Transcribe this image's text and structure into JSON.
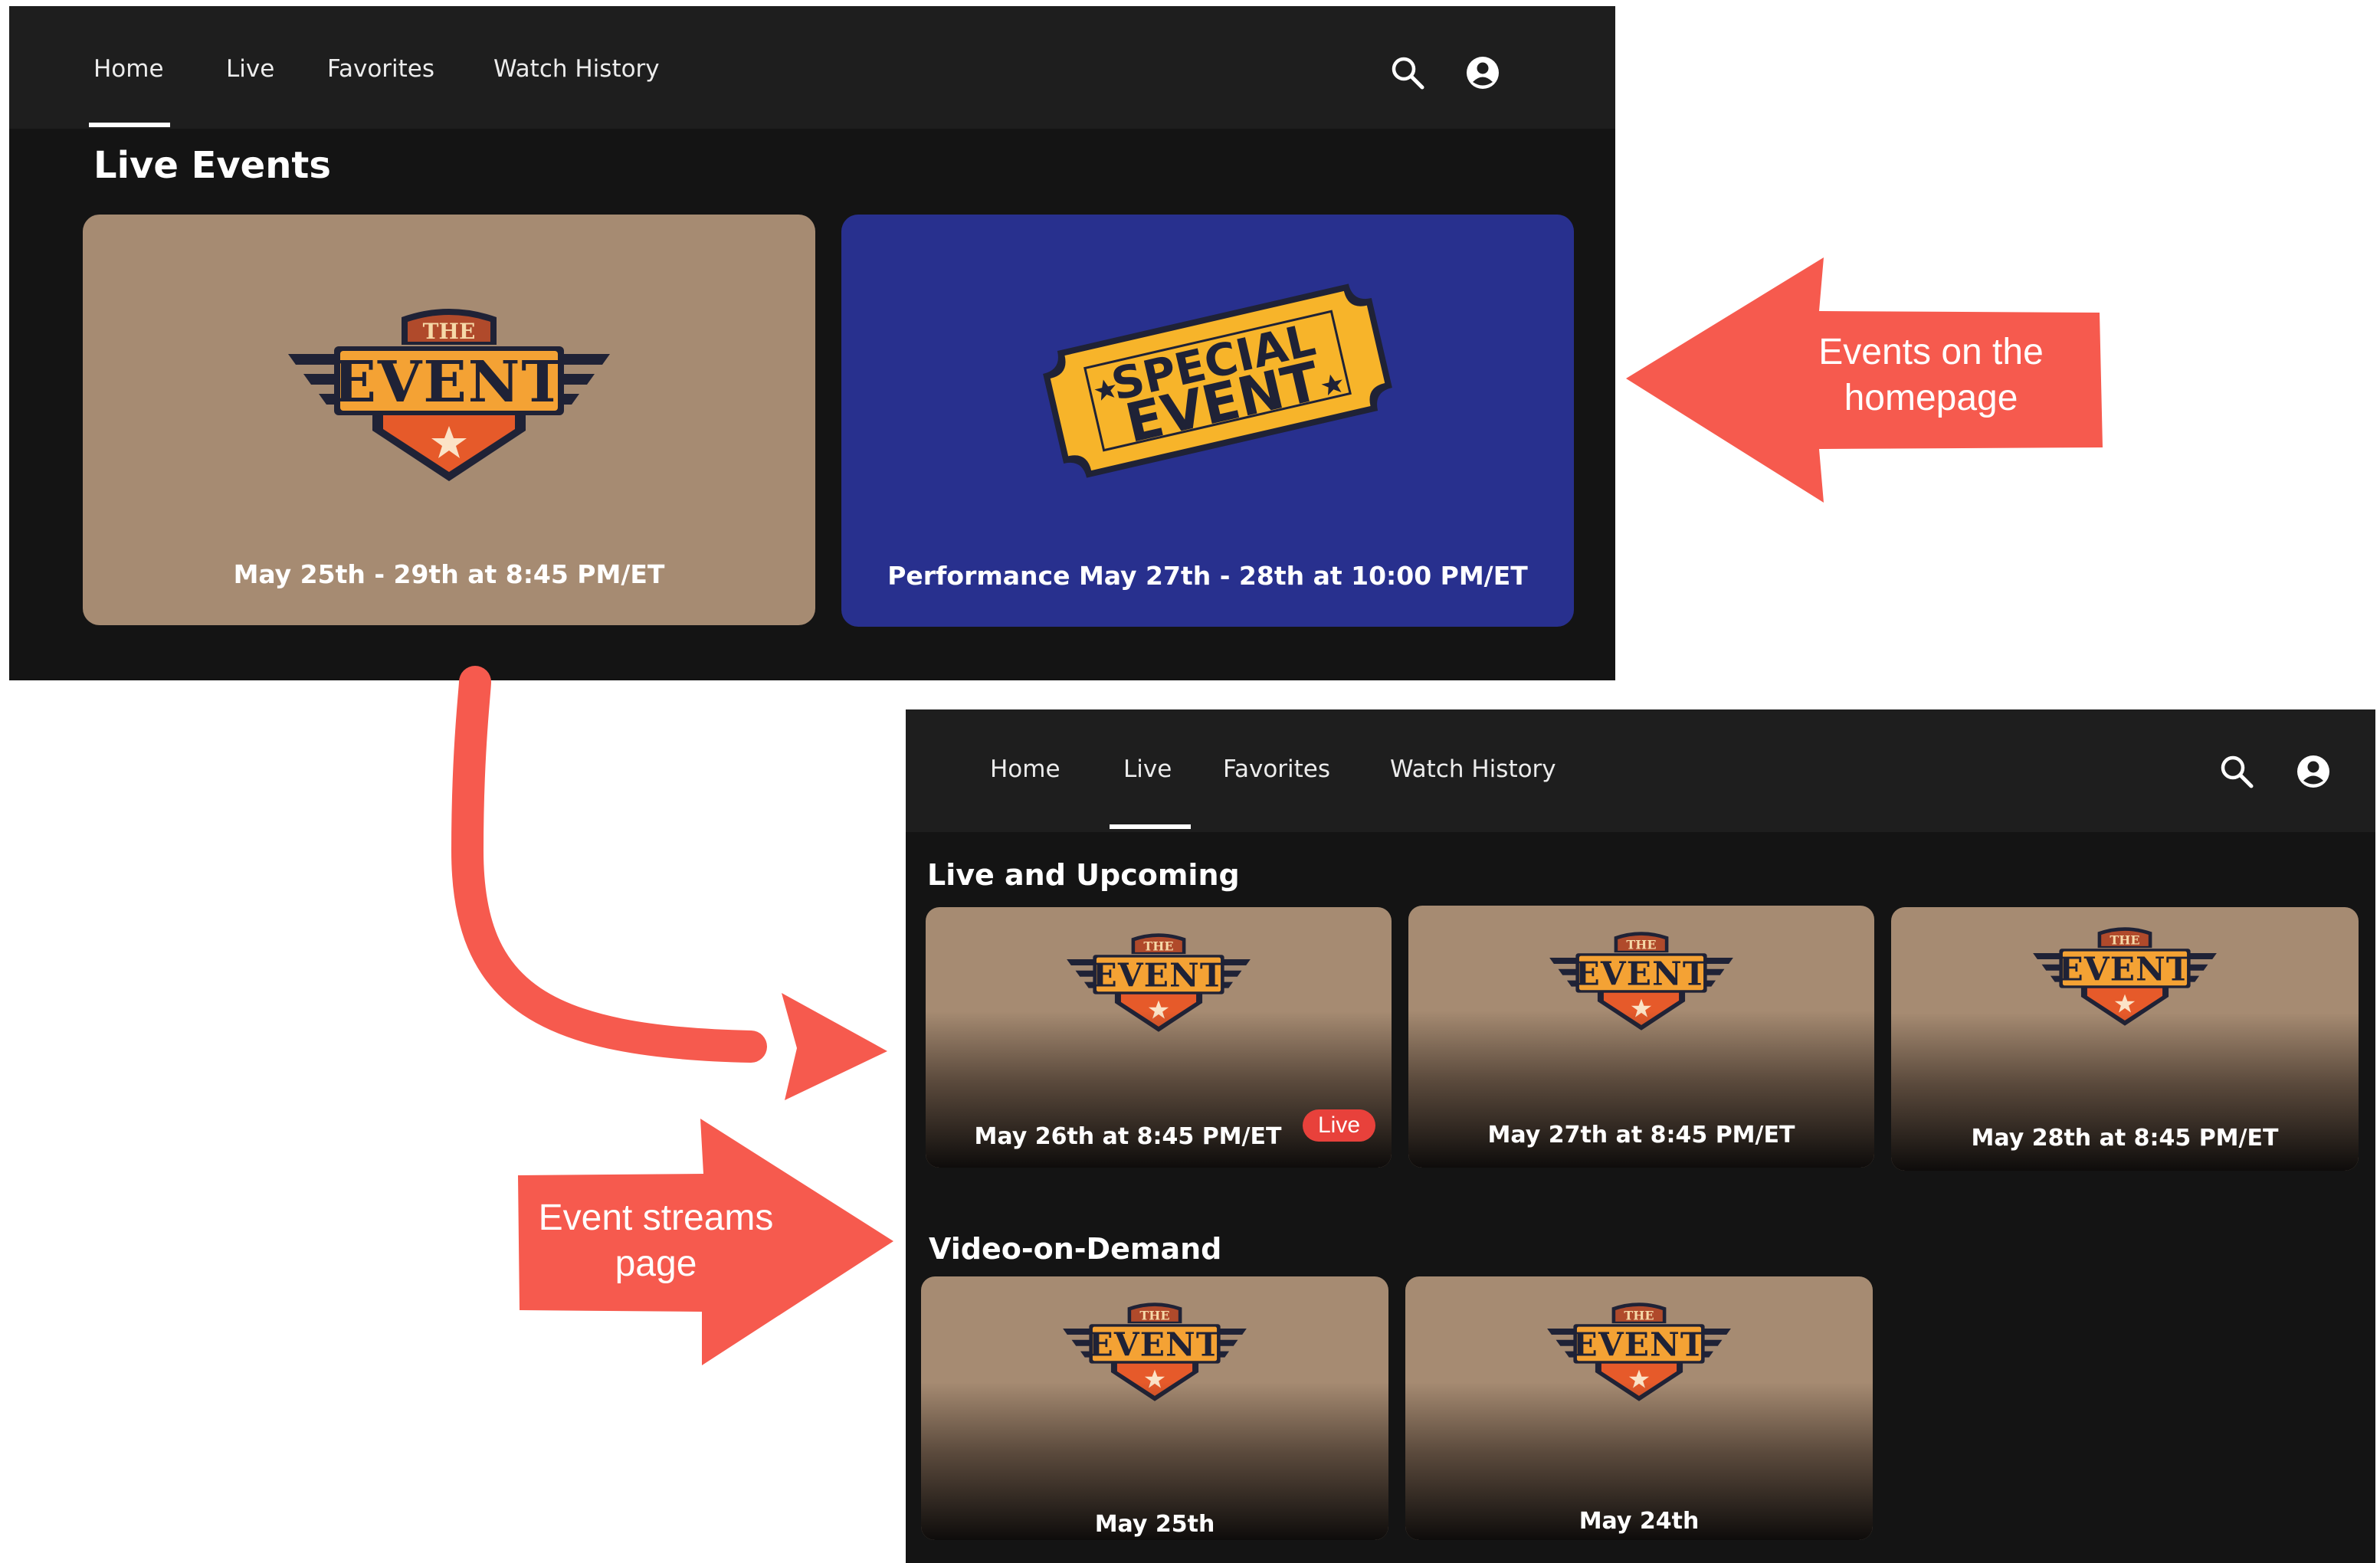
{
  "colors": {
    "panel_bg": "#141414",
    "nav_bg": "#1e1e1e",
    "card_tan": "#a68b72",
    "card_blue": "#28308e",
    "ticket_yellow": "#f7b42a",
    "annotation_red": "#f65a4e",
    "live_badge": "#e8413b",
    "logo_navy": "#1f2236",
    "logo_orange": "#f4a234",
    "logo_rust": "#b04a2b",
    "logo_red": "#e65a2a"
  },
  "homepage": {
    "nav": {
      "items": [
        {
          "label": "Home",
          "active": true
        },
        {
          "label": "Live",
          "active": false
        },
        {
          "label": "Favorites",
          "active": false
        },
        {
          "label": "Watch History",
          "active": false
        }
      ],
      "icons": [
        "search-icon",
        "account-icon"
      ]
    },
    "section_title": "Live Events",
    "cards": [
      {
        "logo_top": "THE",
        "logo_main": "EVENT",
        "caption": "May 25th - 29th at 8:45 PM/ET"
      },
      {
        "ticket_line1": "SPECIAL",
        "ticket_line2": "EVENT",
        "caption": "Performance May 27th - 28th at 10:00 PM/ET"
      }
    ]
  },
  "live_page": {
    "nav": {
      "items": [
        {
          "label": "Home",
          "active": false
        },
        {
          "label": "Live",
          "active": true
        },
        {
          "label": "Favorites",
          "active": false
        },
        {
          "label": "Watch History",
          "active": false
        }
      ],
      "icons": [
        "search-icon",
        "account-icon"
      ]
    },
    "sections": [
      {
        "title": "Live and Upcoming",
        "tiles": [
          {
            "caption": "May 26th at 8:45 PM/ET",
            "badge": "Live"
          },
          {
            "caption": "May 27th at 8:45 PM/ET"
          },
          {
            "caption": "May 28th at 8:45 PM/ET"
          }
        ]
      },
      {
        "title": "Video-on-Demand",
        "tiles": [
          {
            "caption": "May 25th"
          },
          {
            "caption": "May 24th"
          }
        ]
      }
    ]
  },
  "annotations": [
    {
      "text_line1": "Events on the",
      "text_line2": "homepage"
    },
    {
      "text_line1": "Event streams",
      "text_line2": "page"
    }
  ]
}
